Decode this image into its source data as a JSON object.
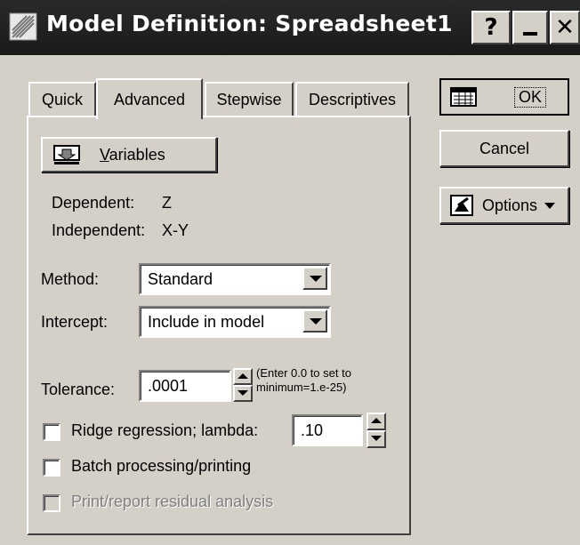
{
  "window": {
    "title": "Model Definition: Spreadsheet1",
    "help_button": "?",
    "minimize_button": "_",
    "close_button": "✕"
  },
  "tabs": [
    {
      "label": "Quick"
    },
    {
      "label": "Advanced",
      "active": true
    },
    {
      "label": "Stepwise"
    },
    {
      "label": "Descriptives"
    }
  ],
  "variables_button": {
    "label": "Variables",
    "underline": "V",
    "rest": "ariables"
  },
  "dependent": {
    "label": "Dependent:",
    "value": "Z"
  },
  "independent": {
    "label": "Independent:",
    "value": "X-Y"
  },
  "method": {
    "label": "Method:",
    "value": "Standard"
  },
  "intercept": {
    "label": "Intercept:",
    "value": "Include in model"
  },
  "tolerance": {
    "label": "Tolerance:",
    "value": ".0001",
    "hint_line1": "(Enter 0.0 to set to",
    "hint_line2": "minimum=1.e-25)"
  },
  "ridge": {
    "label": "Ridge regression; lambda:",
    "value": ".10",
    "checked": false
  },
  "batch": {
    "label": "Batch processing/printing",
    "checked": false
  },
  "residual": {
    "label": "Print/report residual analysis",
    "checked": false,
    "disabled": true
  },
  "side_buttons": {
    "ok": "OK",
    "cancel": "Cancel",
    "options": "Options"
  }
}
